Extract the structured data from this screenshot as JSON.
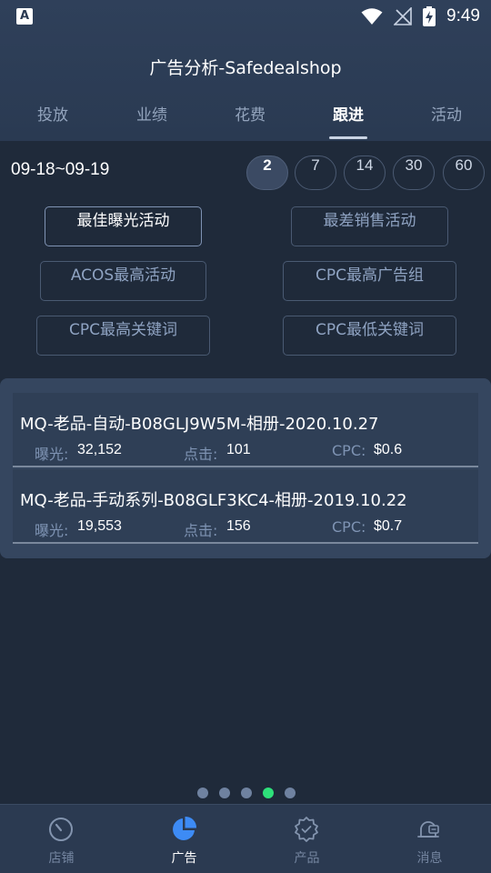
{
  "statusbar": {
    "app_icon_letter": "A",
    "time": "9:49"
  },
  "header": {
    "title": "广告分析-Safedealshop"
  },
  "tabs": [
    {
      "label": "投放"
    },
    {
      "label": "业绩"
    },
    {
      "label": "花费"
    },
    {
      "label": "跟进",
      "active": true
    },
    {
      "label": "活动"
    }
  ],
  "date_range": "09-18~09-19",
  "day_chips": [
    "2",
    "7",
    "14",
    "30",
    "60"
  ],
  "filters": {
    "best_exposure": "最佳曝光活动",
    "worst_sales": "最差销售活动",
    "acos_highest": "ACOS最高活动",
    "cpc_highest_group": "CPC最高广告组",
    "cpc_highest_keyword": "CPC最高关键词",
    "cpc_lowest_keyword": "CPC最低关键词"
  },
  "list": {
    "labels": {
      "impressions": "曝光:",
      "clicks": "点击:",
      "cpc": "CPC:"
    },
    "items": [
      {
        "title": "MQ-老品-自动-B08GLJ9W5M-相册-2020.10.27",
        "impressions": "32,152",
        "clicks": "101",
        "cpc": "$0.6"
      },
      {
        "title": "MQ-老品-手动系列-B08GLF3KC4-相册-2019.10.22",
        "impressions": "19,553",
        "clicks": "156",
        "cpc": "$0.7"
      }
    ]
  },
  "pager": {
    "count": 5,
    "active_index": 3
  },
  "bottom_nav": [
    {
      "label": "店铺",
      "icon": "gauge-icon"
    },
    {
      "label": "广告",
      "icon": "pie-chart-icon",
      "active": true
    },
    {
      "label": "产品",
      "icon": "gear-badge-icon"
    },
    {
      "label": "消息",
      "icon": "bell-icon"
    }
  ],
  "colors": {
    "accent_blue": "#3d8bf5",
    "active_dot": "#2ee07a",
    "background": "#1f2a3a"
  }
}
